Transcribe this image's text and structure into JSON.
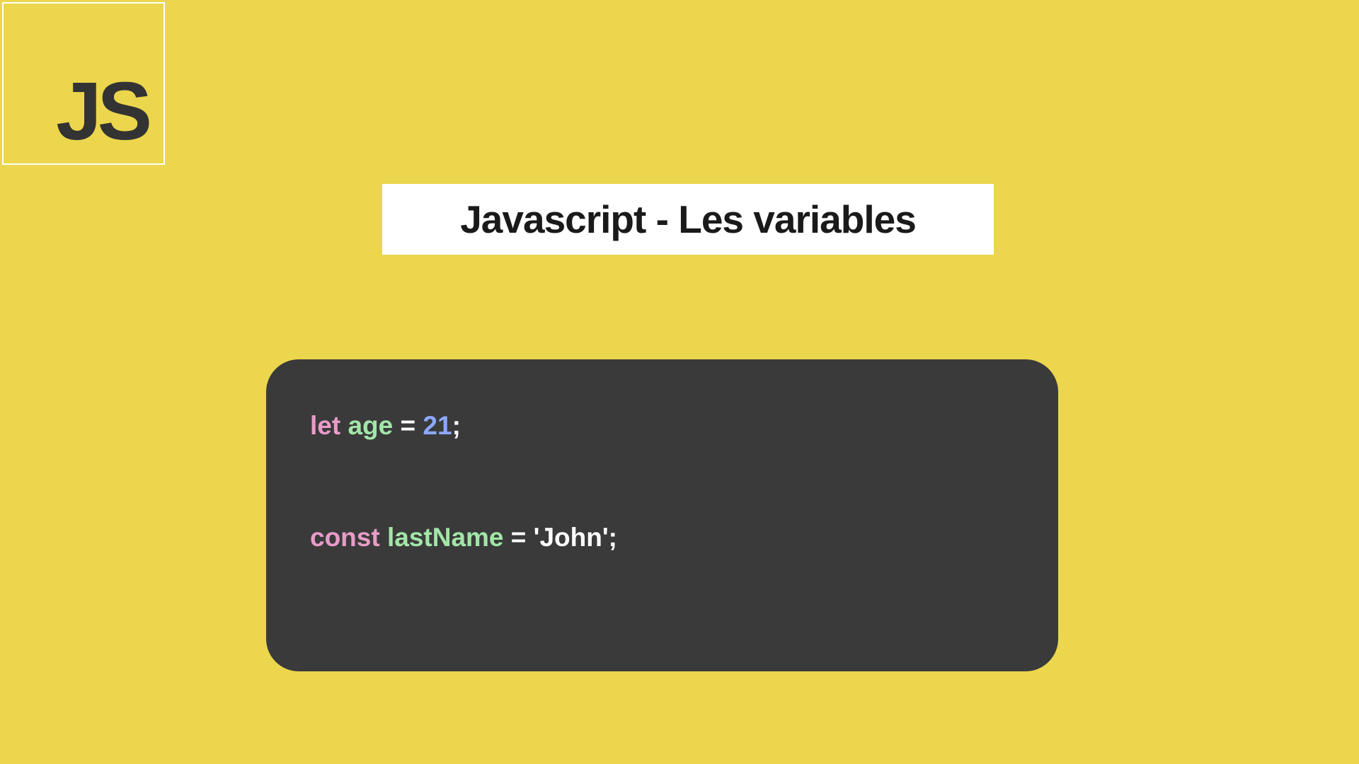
{
  "logo": {
    "text": "JS"
  },
  "title": "Javascript - Les variables",
  "code": {
    "line1": {
      "keyword": "let ",
      "identifier": "age ",
      "operator": "= ",
      "value": "21",
      "punct": ";"
    },
    "line2": {
      "keyword": "const ",
      "identifier": "lastName ",
      "operator": "= ",
      "value": "'John'",
      "punct": ";"
    }
  }
}
